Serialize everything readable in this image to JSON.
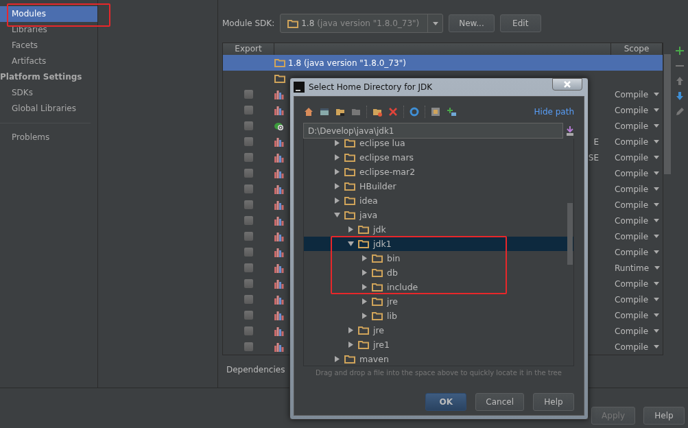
{
  "sidebar": {
    "items": [
      {
        "label": "Modules",
        "kind": "item",
        "selected": true
      },
      {
        "label": "Libraries",
        "kind": "item",
        "selected": false
      },
      {
        "label": "Facets",
        "kind": "item",
        "selected": false
      },
      {
        "label": "Artifacts",
        "kind": "item",
        "selected": false
      },
      {
        "label": "Platform Settings",
        "kind": "header",
        "selected": false
      },
      {
        "label": "SDKs",
        "kind": "item",
        "selected": false
      },
      {
        "label": "Global Libraries",
        "kind": "item",
        "selected": false
      },
      {
        "label": "Problems",
        "kind": "item",
        "selected": false
      }
    ]
  },
  "module_sdk": {
    "label": "Module SDK:",
    "value": "1.8",
    "detail": "(java version \"1.8.0_73\")",
    "buttons": [
      "New...",
      "Edit"
    ]
  },
  "table": {
    "columns": [
      "Export",
      "Scope"
    ],
    "rows": [
      {
        "kind": "sdk",
        "selected": true,
        "name": "1.8 (java version \"1.8.0_73\")"
      },
      {
        "kind": "source",
        "selected": false
      },
      {
        "kind": "library",
        "selected": false,
        "checked": false,
        "scope": "Compile"
      },
      {
        "kind": "library",
        "selected": false,
        "checked": false,
        "scope": "Compile"
      },
      {
        "kind": "plugin",
        "selected": false,
        "checked": false,
        "scope": "Compile"
      },
      {
        "kind": "library",
        "selected": false,
        "checked": false,
        "scope": "Compile",
        "name_tail": "E"
      },
      {
        "kind": "library",
        "selected": false,
        "checked": false,
        "scope": "Compile",
        "name_tail": "SE"
      },
      {
        "kind": "library",
        "selected": false,
        "checked": false,
        "scope": "Compile"
      },
      {
        "kind": "library",
        "selected": false,
        "checked": false,
        "scope": "Compile"
      },
      {
        "kind": "library",
        "selected": false,
        "checked": false,
        "scope": "Compile"
      },
      {
        "kind": "library",
        "selected": false,
        "checked": false,
        "scope": "Compile"
      },
      {
        "kind": "library",
        "selected": false,
        "checked": false,
        "scope": "Compile"
      },
      {
        "kind": "library",
        "selected": false,
        "checked": false,
        "scope": "Compile"
      },
      {
        "kind": "library",
        "selected": false,
        "checked": false,
        "scope": "Runtime"
      },
      {
        "kind": "library",
        "selected": false,
        "checked": false,
        "scope": "Compile"
      },
      {
        "kind": "library",
        "selected": false,
        "checked": false,
        "scope": "Compile"
      },
      {
        "kind": "library",
        "selected": false,
        "checked": false,
        "scope": "Compile"
      },
      {
        "kind": "library",
        "selected": false,
        "checked": false,
        "scope": "Compile"
      },
      {
        "kind": "library",
        "selected": false,
        "checked": false,
        "scope": "Compile"
      }
    ],
    "footer": "Dependencies"
  },
  "bottom_buttons": [
    {
      "label": "Apply",
      "disabled": true
    },
    {
      "label": "Help",
      "disabled": false
    }
  ],
  "dialog": {
    "title": "Select Home Directory for JDK",
    "hide_path": "Hide path",
    "path": "D:\\Develop\\java\\jdk1",
    "tree": [
      {
        "label": "eclipse lua",
        "expanded": false,
        "selected": false
      },
      {
        "label": "eclipse mars",
        "expanded": false,
        "selected": false
      },
      {
        "label": "eclipse-mar2",
        "expanded": false,
        "selected": false
      },
      {
        "label": "HBuilder",
        "expanded": false,
        "selected": false
      },
      {
        "label": "idea",
        "expanded": false,
        "selected": false
      },
      {
        "label": "java",
        "expanded": true,
        "selected": false,
        "children": [
          {
            "label": "jdk",
            "expanded": false,
            "selected": false
          },
          {
            "label": "jdk1",
            "expanded": true,
            "selected": true,
            "children": [
              {
                "label": "bin",
                "expanded": false,
                "selected": false
              },
              {
                "label": "db",
                "expanded": false,
                "selected": false
              },
              {
                "label": "include",
                "expanded": false,
                "selected": false
              },
              {
                "label": "jre",
                "expanded": false,
                "selected": false
              },
              {
                "label": "lib",
                "expanded": false,
                "selected": false
              }
            ]
          },
          {
            "label": "jre",
            "expanded": false,
            "selected": false
          },
          {
            "label": "jre1",
            "expanded": false,
            "selected": false
          }
        ]
      },
      {
        "label": "maven",
        "expanded": false,
        "selected": false
      }
    ],
    "hint": "Drag and drop a file into the space above to quickly locate it in the tree",
    "buttons": [
      {
        "label": "OK",
        "default": true
      },
      {
        "label": "Cancel",
        "default": false
      },
      {
        "label": "Help",
        "default": false
      }
    ]
  }
}
